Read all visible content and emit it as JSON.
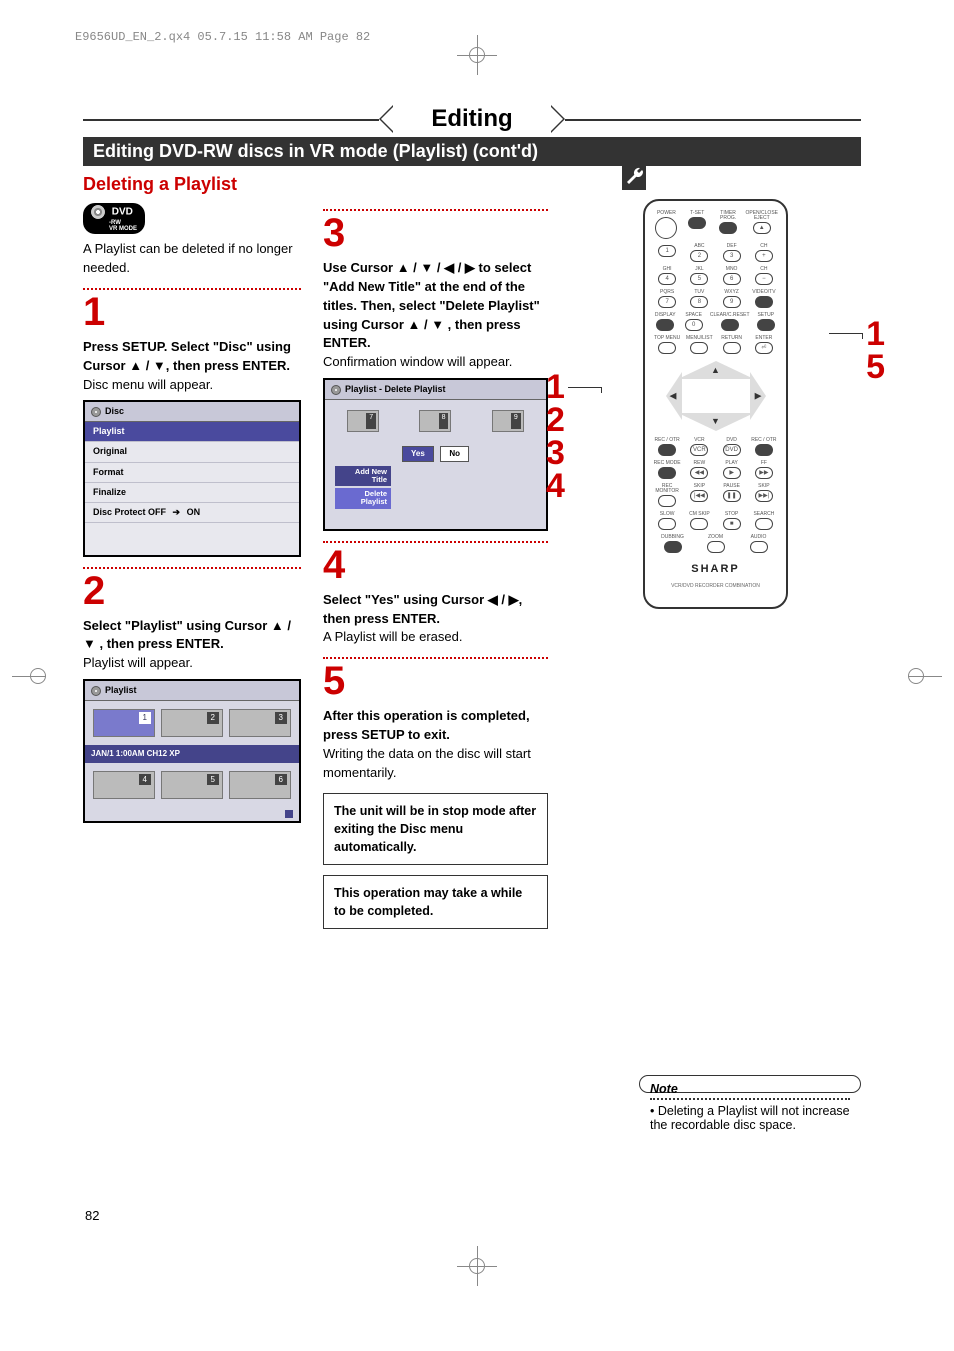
{
  "header_info": "E9656UD_EN_2.qx4  05.7.15  11:58 AM  Page 82",
  "page_number": "82",
  "title": "Editing",
  "subtitle": "Editing DVD-RW discs in VR mode (Playlist) (cont'd)",
  "section": "Deleting a Playlist",
  "dvd_badge": {
    "main": "DVD",
    "sub1": "-RW",
    "sub2": "VR MODE"
  },
  "intro": "A Playlist can be deleted if no longer needed.",
  "steps": {
    "s1": {
      "num": "1",
      "bold": "Press SETUP. Select \"Disc\" using Cursor ▲ / ▼, then press ENTER.",
      "text": "Disc menu will appear."
    },
    "s2": {
      "num": "2",
      "bold": "Select \"Playlist\" using Cursor ▲ / ▼ , then press ENTER.",
      "text": "Playlist will appear."
    },
    "s3": {
      "num": "3",
      "bold": "Use Cursor ▲ / ▼ / ◀ / ▶ to select \"Add New Title\" at the end of the titles.  Then, select \"Delete Playlist\" using Cursor ▲ / ▼ , then press ENTER.",
      "text": "Confirmation window will appear."
    },
    "s4": {
      "num": "4",
      "bold": "Select \"Yes\" using Cursor ◀ / ▶, then press ENTER.",
      "text": "A Playlist will be erased."
    },
    "s5": {
      "num": "5",
      "bold": "After this operation is completed, press SETUP to exit.",
      "text": "Writing the data on the disc will start momentarily."
    }
  },
  "callout1": "The unit will be in stop mode after exiting the Disc menu automatically.",
  "callout2": "This operation may take a while to be completed.",
  "osd_disc": {
    "title": "Disc",
    "items": [
      "Playlist",
      "Original",
      "Format",
      "Finalize"
    ],
    "protect_label": "Disc Protect OFF",
    "protect_arrow": "➔",
    "protect_on": "ON"
  },
  "osd_playlist": {
    "title": "Playlist",
    "thumbs": [
      "1",
      "2",
      "3",
      "4",
      "5",
      "6"
    ],
    "info": "JAN/1 1:00AM CH12 XP"
  },
  "osd_confirm": {
    "title": "Playlist - Delete Playlist",
    "thumbs": [
      "7",
      "8",
      "9"
    ],
    "yes": "Yes",
    "no": "No",
    "btn_add_l1": "Add New",
    "btn_add_l2": "Title",
    "btn_del_l1": "Delete",
    "btn_del_l2": "Playlist"
  },
  "remote_side_left": [
    "1",
    "2",
    "3",
    "4"
  ],
  "remote_side_right": [
    "1",
    "5"
  ],
  "remote": {
    "r0": [
      "POWER",
      "T-SET",
      "TIMER PROG.",
      "OPEN/CLOSE EJECT"
    ],
    "r1_lbl": [
      "",
      "ABC",
      "DEF",
      ""
    ],
    "r1": [
      "1",
      "2",
      "3",
      "CH +"
    ],
    "r2_lbl": [
      "GHI",
      "JKL",
      "MNO",
      ""
    ],
    "r2": [
      "4",
      "5",
      "6",
      "CH −"
    ],
    "r3_lbl": [
      "PQRS",
      "TUV",
      "WXYZ",
      "VIDEO/TV"
    ],
    "r3": [
      "7",
      "8",
      "9",
      ""
    ],
    "r4_lbl": [
      "DISPLAY",
      "SPACE",
      "CLEAR/C.RESET",
      "SETUP"
    ],
    "r4": [
      "",
      "0",
      "",
      ""
    ],
    "r5_lbl": [
      "TOP MENU",
      "MENU/LIST",
      "RETURN",
      "ENTER"
    ],
    "r6_lbl": [
      "REC / OTR",
      "",
      "",
      "DVD",
      "",
      "REC / OTR"
    ],
    "r7_lbl": [
      "REC MODE",
      "",
      "PLAY",
      ""
    ],
    "r8_lbl": [
      "REC MONITOR",
      "SKIP",
      "PAUSE",
      "SKIP"
    ],
    "r9_lbl": [
      "SLOW",
      "CM SKIP",
      "STOP",
      "SEARCH"
    ],
    "r10_lbl": [
      "DUBBING",
      "ZOOM",
      "AUDIO"
    ],
    "brand": "SHARP",
    "subbrand": "VCR/DVD RECORDER\nCOMBINATION"
  },
  "note": {
    "title": "Note",
    "text": "• Deleting a Playlist will not increase the recordable disc space."
  }
}
